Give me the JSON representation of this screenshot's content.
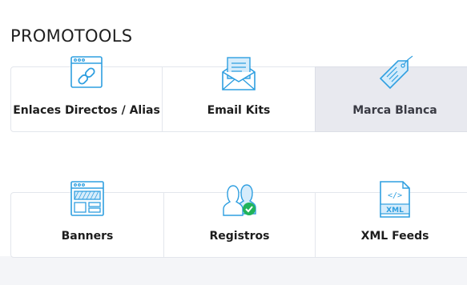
{
  "page": {
    "title": "PROMOTOOLS"
  },
  "tools": {
    "row1": [
      {
        "label": "Enlaces Directos / Alias",
        "icon": "link-window-icon",
        "active": false
      },
      {
        "label": "Email Kits",
        "icon": "email-envelope-icon",
        "active": false
      },
      {
        "label": "Marca Blanca",
        "icon": "price-tag-icon",
        "active": true
      }
    ],
    "row2": [
      {
        "label": "Banners",
        "icon": "banner-window-icon",
        "active": false
      },
      {
        "label": "Registros",
        "icon": "users-check-icon",
        "active": false
      },
      {
        "label": "XML Feeds",
        "icon": "xml-file-icon",
        "active": false
      }
    ]
  },
  "colors": {
    "icon_stroke": "#2f9fe0",
    "icon_fill": "#d6ecfb",
    "check_green": "#21b35a",
    "active_bg": "#e8e9ef"
  },
  "icon_labels": {
    "xml": "XML",
    "code": "</>"
  }
}
